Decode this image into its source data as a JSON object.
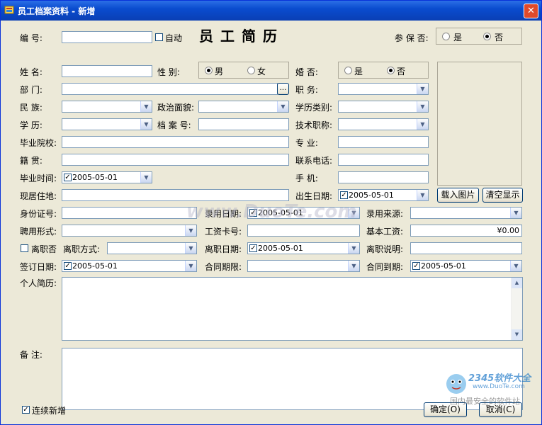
{
  "window": {
    "title": "员工档案资料 - 新增",
    "close": "✕"
  },
  "heading": "员工简历",
  "form": {
    "number": {
      "label": "编    号:",
      "value": "",
      "auto_label": "自动"
    },
    "insured": {
      "label": "参 保 否:",
      "yes": "是",
      "no": "否",
      "selected": "否"
    },
    "name": {
      "label": "姓    名:",
      "value": ""
    },
    "gender": {
      "label": "性    别:",
      "male": "男",
      "female": "女",
      "selected": "男"
    },
    "married": {
      "label": "婚    否:",
      "yes": "是",
      "no": "否",
      "selected": "否"
    },
    "department": {
      "label": "部    门:",
      "value": "",
      "browse": "..."
    },
    "position": {
      "label": "职    务:",
      "value": ""
    },
    "ethnicity": {
      "label": "民    族:",
      "value": ""
    },
    "political": {
      "label": "政治面貌:",
      "value": ""
    },
    "edu_category": {
      "label": "学历类别:",
      "value": ""
    },
    "education": {
      "label": "学    历:",
      "value": ""
    },
    "archive_no": {
      "label": "档 案 号:",
      "value": ""
    },
    "tech_title": {
      "label": "技术职称:",
      "value": ""
    },
    "school": {
      "label": "毕业院校:",
      "value": ""
    },
    "major": {
      "label": "专    业:",
      "value": ""
    },
    "native": {
      "label": "籍    贯:",
      "value": ""
    },
    "phone": {
      "label": "联系电话:",
      "value": ""
    },
    "grad_time": {
      "label": "毕业时间:",
      "value": "2005-05-01"
    },
    "mobile": {
      "label": "手    机:",
      "value": ""
    },
    "address": {
      "label": "现居住地:",
      "value": ""
    },
    "birth": {
      "label": "出生日期:",
      "value": "2005-05-01"
    },
    "id_no": {
      "label": "身份证号:",
      "value": ""
    },
    "hire_date": {
      "label": "录用日期:",
      "value": "2005-05-01"
    },
    "hire_source": {
      "label": "录用来源:",
      "value": ""
    },
    "employ_form": {
      "label": "聘用形式:",
      "value": ""
    },
    "salary_card": {
      "label": "工资卡号:",
      "value": ""
    },
    "base_salary": {
      "label": "基本工资:",
      "value": "¥0.00"
    },
    "resigned": {
      "label": "离职否"
    },
    "resign_way": {
      "label": "离职方式:",
      "value": ""
    },
    "resign_date": {
      "label": "离职日期:",
      "value": "2005-05-01"
    },
    "resign_note": {
      "label": "离职说明:",
      "value": ""
    },
    "sign_date": {
      "label": "签订日期:",
      "value": "2005-05-01"
    },
    "contract_term": {
      "label": "合同期限:",
      "value": ""
    },
    "contract_end": {
      "label": "合同到期:",
      "value": "2005-05-01"
    },
    "resume": {
      "label": "个人简历:",
      "value": ""
    },
    "remark": {
      "label": "备    注:",
      "value": ""
    }
  },
  "buttons": {
    "load_photo": "载入图片",
    "clear_photo": "清空显示",
    "continuous_add": "连续新增",
    "ok": "确定(O)",
    "cancel": "取消(C)"
  },
  "watermarks": {
    "center": "www.DuoTe.com",
    "logo_brand": "2345软件大全",
    "logo_url": "www.DuoTe.com",
    "logo_slogan": "国内最安全的软件站"
  }
}
